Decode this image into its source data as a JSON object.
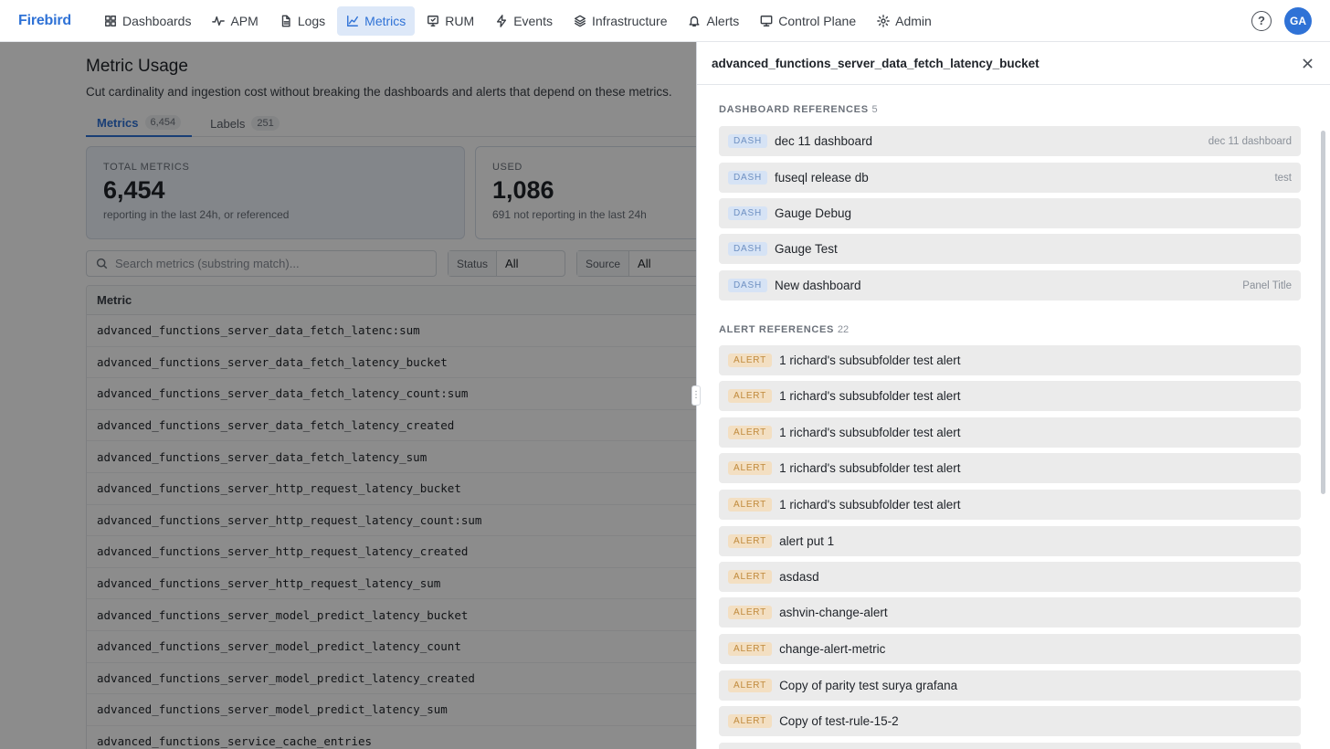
{
  "nav": {
    "brand": "Firebird",
    "items": [
      {
        "label": "Dashboards",
        "icon": "grid-icon"
      },
      {
        "label": "APM",
        "icon": "activity-icon"
      },
      {
        "label": "Logs",
        "icon": "document-icon"
      },
      {
        "label": "Metrics",
        "icon": "chart-icon",
        "active": true
      },
      {
        "label": "RUM",
        "icon": "monitor-icon"
      },
      {
        "label": "Events",
        "icon": "bolt-icon"
      },
      {
        "label": "Infrastructure",
        "icon": "layers-icon"
      },
      {
        "label": "Alerts",
        "icon": "bell-icon"
      },
      {
        "label": "Control Plane",
        "icon": "screen-icon"
      },
      {
        "label": "Admin",
        "icon": "gear-icon"
      }
    ],
    "help_symbol": "?",
    "avatar_initials": "GA"
  },
  "page": {
    "title": "Metric Usage",
    "subtitle": "Cut cardinality and ingestion cost without breaking the dashboards and alerts that depend on these metrics.",
    "tabs": [
      {
        "label": "Metrics",
        "count": "6,454",
        "active": true
      },
      {
        "label": "Labels",
        "count": "251"
      }
    ],
    "cards": [
      {
        "label": "TOTAL METRICS",
        "value": "6,454",
        "desc": "reporting in the last 24h, or referenced"
      },
      {
        "label": "USED",
        "value": "1,086",
        "desc": "691 not reporting in the last 24h"
      }
    ],
    "search_placeholder": "Search metrics (substring match)...",
    "filters": [
      {
        "label": "Status",
        "value": "All"
      },
      {
        "label": "Source",
        "value": "All"
      }
    ],
    "table": {
      "header": "Metric",
      "rows": [
        "advanced_functions_server_data_fetch_latenc:sum",
        "advanced_functions_server_data_fetch_latency_bucket",
        "advanced_functions_server_data_fetch_latency_count:sum",
        "advanced_functions_server_data_fetch_latency_created",
        "advanced_functions_server_data_fetch_latency_sum",
        "advanced_functions_server_http_request_latency_bucket",
        "advanced_functions_server_http_request_latency_count:sum",
        "advanced_functions_server_http_request_latency_created",
        "advanced_functions_server_http_request_latency_sum",
        "advanced_functions_server_model_predict_latency_bucket",
        "advanced_functions_server_model_predict_latency_count",
        "advanced_functions_server_model_predict_latency_created",
        "advanced_functions_server_model_predict_latency_sum",
        "advanced_functions_service_cache_entries"
      ]
    }
  },
  "drawer": {
    "title": "advanced_functions_server_data_fetch_latency_bucket",
    "dashboard_refs": {
      "label": "DASHBOARD REFERENCES",
      "count": "5",
      "items": [
        {
          "badge": "DASH",
          "name": "dec 11 dashboard",
          "sub": "dec 11 dashboard"
        },
        {
          "badge": "DASH",
          "name": "fuseql release db",
          "sub": "test"
        },
        {
          "badge": "DASH",
          "name": "Gauge Debug",
          "sub": ""
        },
        {
          "badge": "DASH",
          "name": "Gauge Test",
          "sub": ""
        },
        {
          "badge": "DASH",
          "name": "New dashboard",
          "sub": "Panel Title"
        }
      ]
    },
    "alert_refs": {
      "label": "ALERT REFERENCES",
      "count": "22",
      "items": [
        {
          "badge": "ALERT",
          "name": "1 richard's subsubfolder test alert"
        },
        {
          "badge": "ALERT",
          "name": "1 richard's subsubfolder test alert"
        },
        {
          "badge": "ALERT",
          "name": "1 richard's subsubfolder test alert"
        },
        {
          "badge": "ALERT",
          "name": "1 richard's subsubfolder test alert"
        },
        {
          "badge": "ALERT",
          "name": "1 richard's subsubfolder test alert"
        },
        {
          "badge": "ALERT",
          "name": "alert put 1"
        },
        {
          "badge": "ALERT",
          "name": "asdasd"
        },
        {
          "badge": "ALERT",
          "name": "ashvin-change-alert"
        },
        {
          "badge": "ALERT",
          "name": "change-alert-metric"
        },
        {
          "badge": "ALERT",
          "name": "Copy of parity test surya grafana"
        },
        {
          "badge": "ALERT",
          "name": "Copy of test-rule-15-2"
        }
      ]
    }
  },
  "colors": {
    "brand": "#2f72d6",
    "dash_badge": "#d6e3f5",
    "alert_badge": "#f3dfc2"
  }
}
